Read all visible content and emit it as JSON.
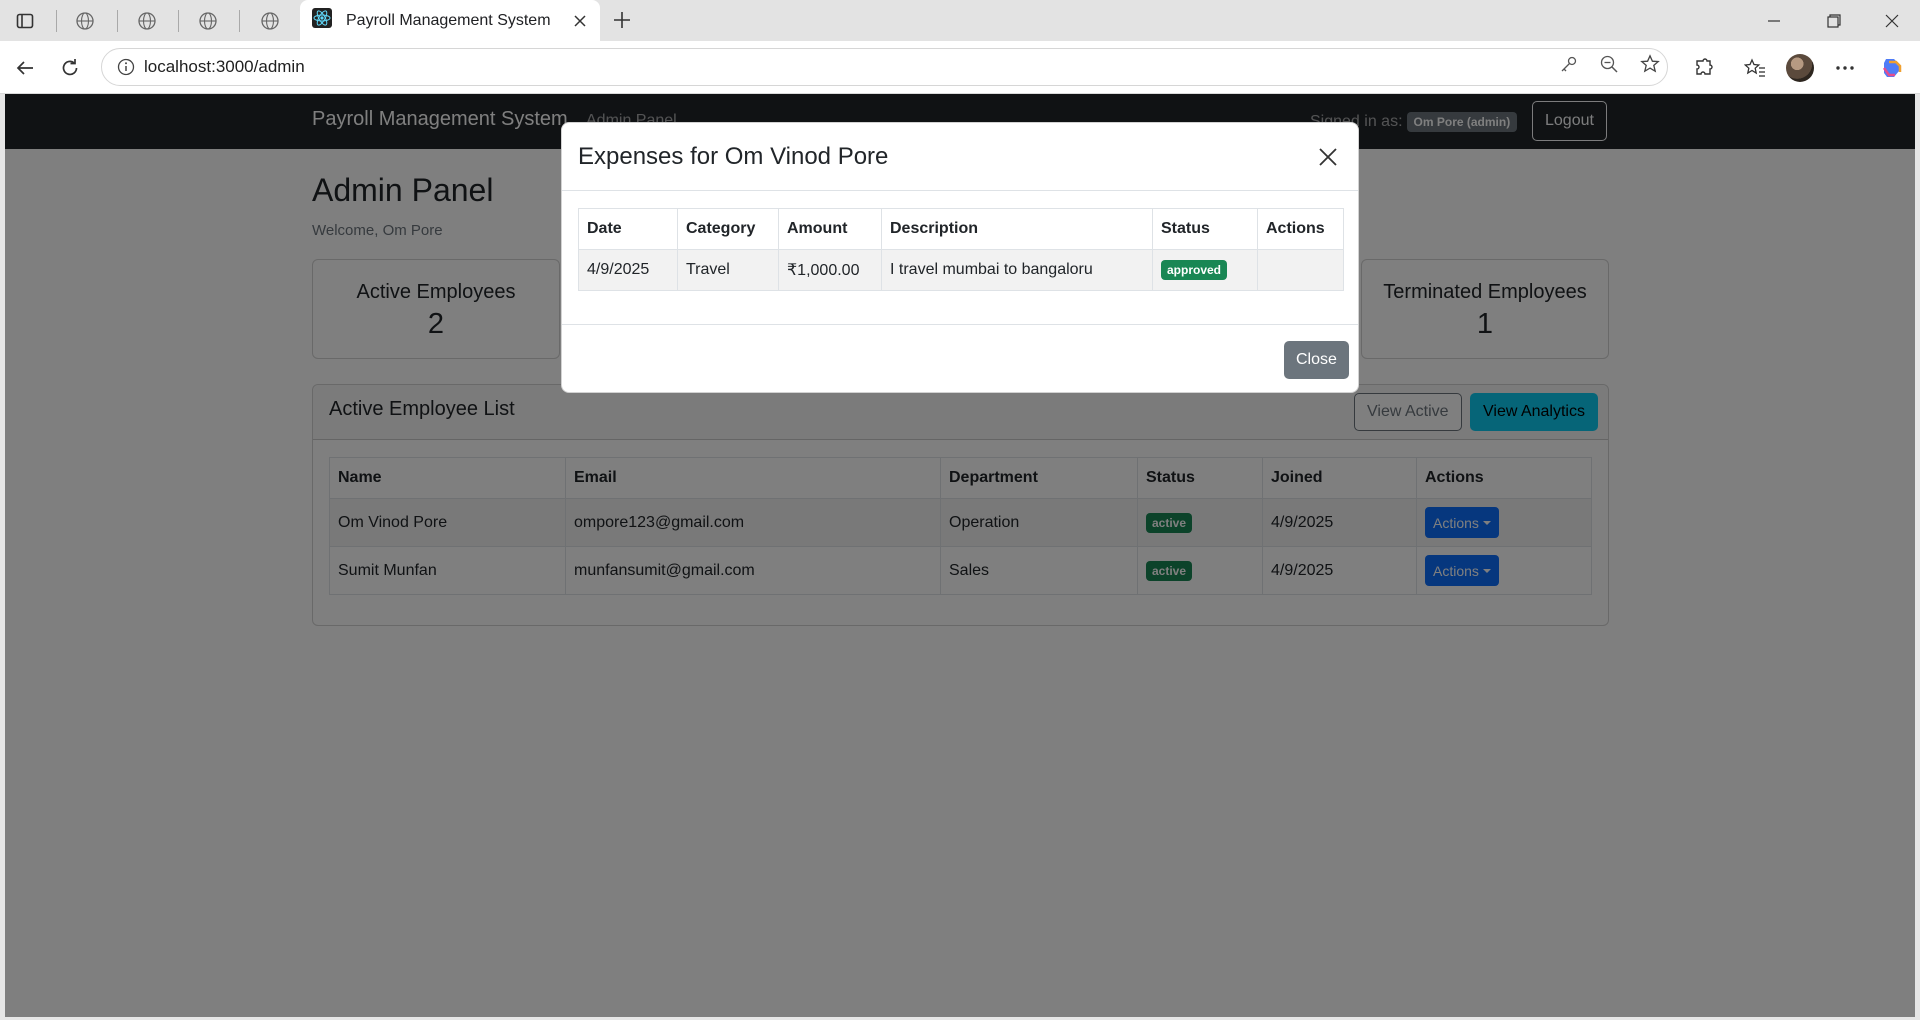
{
  "browser": {
    "tab_title": "Payroll Management System",
    "url": "localhost:3000/admin"
  },
  "navbar": {
    "brand": "Payroll Management System",
    "link": "Admin Panel",
    "signed_in_label": "Signed in as:",
    "user_badge": "Om Pore (admin)",
    "logout": "Logout"
  },
  "page": {
    "title": "Admin Panel",
    "welcome": "Welcome, Om Pore"
  },
  "stats": {
    "active": {
      "label": "Active Employees",
      "value": "2"
    },
    "terminated": {
      "label": "Terminated Employees",
      "value": "1"
    }
  },
  "employee_list": {
    "title": "Active Employee List",
    "view_active": "View Active",
    "view_analytics": "View Analytics",
    "columns": [
      "Name",
      "Email",
      "Department",
      "Status",
      "Joined",
      "Actions"
    ],
    "rows": [
      {
        "name": "Om Vinod Pore",
        "email": "ompore123@gmail.com",
        "department": "Operation",
        "status": "active",
        "joined": "4/9/2025",
        "action": "Actions"
      },
      {
        "name": "Sumit Munfan",
        "email": "munfansumit@gmail.com",
        "department": "Sales",
        "status": "active",
        "joined": "4/9/2025",
        "action": "Actions"
      }
    ]
  },
  "modal": {
    "title": "Expenses for Om Vinod Pore",
    "columns": [
      "Date",
      "Category",
      "Amount",
      "Description",
      "Status",
      "Actions"
    ],
    "rows": [
      {
        "date": "4/9/2025",
        "category": "Travel",
        "amount": "₹1,000.00",
        "description": "I travel mumbai to bangaloru",
        "status": "approved",
        "actions": ""
      }
    ],
    "close_label": "Close"
  },
  "colors": {
    "navbar": "#212529",
    "primary": "#0d6efd",
    "info": "#0dcaf0",
    "success": "#198754",
    "secondary": "#6c757d"
  }
}
